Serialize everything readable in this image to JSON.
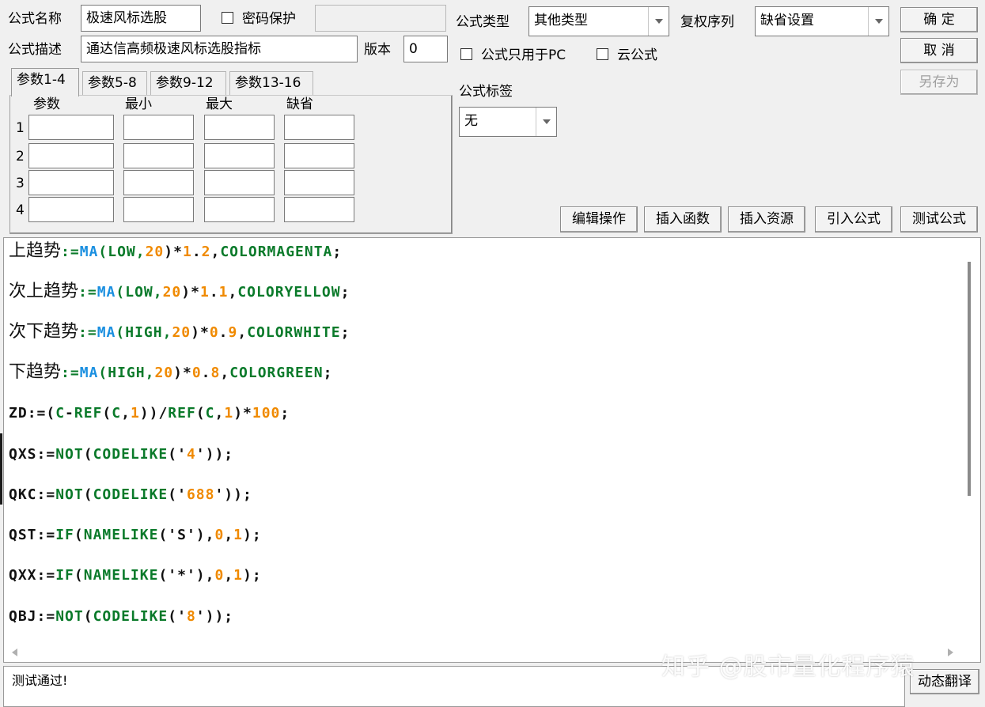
{
  "header": {
    "name_label": "公式名称",
    "name_value": "极速风标选股",
    "password_label": "密码保护",
    "desc_label": "公式描述",
    "desc_value": "通达信高频极速风标选股指标",
    "version_label": "版本",
    "version_value": "0"
  },
  "type_panel": {
    "type_label": "公式类型",
    "type_value": "其他类型",
    "rights_label": "复权序列",
    "rights_value": "缺省设置",
    "pc_only_label": "公式只用于PC",
    "cloud_label": "云公式",
    "tag_label": "公式标签",
    "tag_value": "无"
  },
  "buttons": {
    "ok": "确  定",
    "cancel": "取  消",
    "save_as": "另存为",
    "edit_ops": "编辑操作",
    "insert_func": "插入函数",
    "insert_res": "插入资源",
    "import_formula": "引入公式",
    "test_formula": "测试公式",
    "dyn_translate": "动态翻译"
  },
  "tabs": [
    "参数1-4",
    "参数5-8",
    "参数9-12",
    "参数13-16"
  ],
  "params": {
    "headers": [
      "参数",
      "最小",
      "最大",
      "缺省"
    ],
    "rows": [
      "1",
      "2",
      "3",
      "4"
    ]
  },
  "code": [
    [
      {
        "t": "上趋势",
        "c": "cjk"
      },
      {
        "t": ":=",
        "c": "#0a7a2a"
      },
      {
        "t": "MA",
        "c": "#1a8fe0"
      },
      {
        "t": "(",
        "c": "#0a7a2a"
      },
      {
        "t": "LOW",
        "c": "#0a7a2a"
      },
      {
        "t": ",",
        "c": "#0a7a2a"
      },
      {
        "t": "20",
        "c": "#f08a00"
      },
      {
        "t": ")*",
        "c": "#111111"
      },
      {
        "t": "1",
        "c": "#f08a00"
      },
      {
        "t": ".",
        "c": "#111111"
      },
      {
        "t": "2",
        "c": "#f08a00"
      },
      {
        "t": ",",
        "c": "#111111"
      },
      {
        "t": "COLORMAGENTA",
        "c": "#0a7a2a"
      },
      {
        "t": ";",
        "c": "#111111"
      }
    ],
    [
      {
        "t": "次上趋势",
        "c": "cjk"
      },
      {
        "t": ":=",
        "c": "#0a7a2a"
      },
      {
        "t": "MA",
        "c": "#1a8fe0"
      },
      {
        "t": "(",
        "c": "#0a7a2a"
      },
      {
        "t": "LOW",
        "c": "#0a7a2a"
      },
      {
        "t": ",",
        "c": "#0a7a2a"
      },
      {
        "t": "20",
        "c": "#f08a00"
      },
      {
        "t": ")*",
        "c": "#111111"
      },
      {
        "t": "1",
        "c": "#f08a00"
      },
      {
        "t": ".",
        "c": "#111111"
      },
      {
        "t": "1",
        "c": "#f08a00"
      },
      {
        "t": ",",
        "c": "#111111"
      },
      {
        "t": "COLORYELLOW",
        "c": "#0a7a2a"
      },
      {
        "t": ";",
        "c": "#111111"
      }
    ],
    [
      {
        "t": "次下趋势",
        "c": "cjk"
      },
      {
        "t": ":=",
        "c": "#0a7a2a"
      },
      {
        "t": "MA",
        "c": "#1a8fe0"
      },
      {
        "t": "(",
        "c": "#0a7a2a"
      },
      {
        "t": "HIGH",
        "c": "#0a7a2a"
      },
      {
        "t": ",",
        "c": "#0a7a2a"
      },
      {
        "t": "20",
        "c": "#f08a00"
      },
      {
        "t": ")*",
        "c": "#111111"
      },
      {
        "t": "0",
        "c": "#f08a00"
      },
      {
        "t": ".",
        "c": "#111111"
      },
      {
        "t": "9",
        "c": "#f08a00"
      },
      {
        "t": ",",
        "c": "#111111"
      },
      {
        "t": "COLORWHITE",
        "c": "#0a7a2a"
      },
      {
        "t": ";",
        "c": "#111111"
      }
    ],
    [
      {
        "t": "下趋势",
        "c": "cjk"
      },
      {
        "t": ":=",
        "c": "#0a7a2a"
      },
      {
        "t": "MA",
        "c": "#1a8fe0"
      },
      {
        "t": "(",
        "c": "#0a7a2a"
      },
      {
        "t": "HIGH",
        "c": "#0a7a2a"
      },
      {
        "t": ",",
        "c": "#0a7a2a"
      },
      {
        "t": "20",
        "c": "#f08a00"
      },
      {
        "t": ")*",
        "c": "#111111"
      },
      {
        "t": "0",
        "c": "#f08a00"
      },
      {
        "t": ".",
        "c": "#111111"
      },
      {
        "t": "8",
        "c": "#f08a00"
      },
      {
        "t": ",",
        "c": "#111111"
      },
      {
        "t": "COLORGREEN",
        "c": "#0a7a2a"
      },
      {
        "t": ";",
        "c": "#111111"
      }
    ],
    [
      {
        "t": "ZD",
        "c": "#111111"
      },
      {
        "t": ":=(",
        "c": "#111111"
      },
      {
        "t": "C",
        "c": "#0a7a2a"
      },
      {
        "t": "-",
        "c": "#111111"
      },
      {
        "t": "REF",
        "c": "#0a7a2a"
      },
      {
        "t": "(",
        "c": "#111111"
      },
      {
        "t": "C",
        "c": "#0a7a2a"
      },
      {
        "t": ",",
        "c": "#111111"
      },
      {
        "t": "1",
        "c": "#f08a00"
      },
      {
        "t": "))/",
        "c": "#111111"
      },
      {
        "t": "REF",
        "c": "#0a7a2a"
      },
      {
        "t": "(",
        "c": "#111111"
      },
      {
        "t": "C",
        "c": "#0a7a2a"
      },
      {
        "t": ",",
        "c": "#111111"
      },
      {
        "t": "1",
        "c": "#f08a00"
      },
      {
        "t": ")*",
        "c": "#111111"
      },
      {
        "t": "100",
        "c": "#f08a00"
      },
      {
        "t": ";",
        "c": "#111111"
      }
    ],
    [
      {
        "t": "QXS",
        "c": "#111111"
      },
      {
        "t": ":=",
        "c": "#111111"
      },
      {
        "t": "NOT",
        "c": "#0a7a2a"
      },
      {
        "t": "(",
        "c": "#111111"
      },
      {
        "t": "CODELIKE",
        "c": "#0a7a2a"
      },
      {
        "t": "('",
        "c": "#111111"
      },
      {
        "t": "4",
        "c": "#f08a00"
      },
      {
        "t": "'));",
        "c": "#111111"
      }
    ],
    [
      {
        "t": "QKC",
        "c": "#111111"
      },
      {
        "t": ":=",
        "c": "#111111"
      },
      {
        "t": "NOT",
        "c": "#0a7a2a"
      },
      {
        "t": "(",
        "c": "#111111"
      },
      {
        "t": "CODELIKE",
        "c": "#0a7a2a"
      },
      {
        "t": "('",
        "c": "#111111"
      },
      {
        "t": "688",
        "c": "#f08a00"
      },
      {
        "t": "'));",
        "c": "#111111"
      }
    ],
    [
      {
        "t": "QST",
        "c": "#111111"
      },
      {
        "t": ":=",
        "c": "#111111"
      },
      {
        "t": "IF",
        "c": "#0a7a2a"
      },
      {
        "t": "(",
        "c": "#111111"
      },
      {
        "t": "NAMELIKE",
        "c": "#0a7a2a"
      },
      {
        "t": "('S'),",
        "c": "#111111"
      },
      {
        "t": "0",
        "c": "#f08a00"
      },
      {
        "t": ",",
        "c": "#111111"
      },
      {
        "t": "1",
        "c": "#f08a00"
      },
      {
        "t": ");",
        "c": "#111111"
      }
    ],
    [
      {
        "t": "QXX",
        "c": "#111111"
      },
      {
        "t": ":=",
        "c": "#111111"
      },
      {
        "t": "IF",
        "c": "#0a7a2a"
      },
      {
        "t": "(",
        "c": "#111111"
      },
      {
        "t": "NAMELIKE",
        "c": "#0a7a2a"
      },
      {
        "t": "('*'),",
        "c": "#111111"
      },
      {
        "t": "0",
        "c": "#f08a00"
      },
      {
        "t": ",",
        "c": "#111111"
      },
      {
        "t": "1",
        "c": "#f08a00"
      },
      {
        "t": ");",
        "c": "#111111"
      }
    ],
    [
      {
        "t": "QBJ",
        "c": "#111111"
      },
      {
        "t": ":=",
        "c": "#111111"
      },
      {
        "t": "NOT",
        "c": "#0a7a2a"
      },
      {
        "t": "(",
        "c": "#111111"
      },
      {
        "t": "CODELIKE",
        "c": "#0a7a2a"
      },
      {
        "t": "('",
        "c": "#111111"
      },
      {
        "t": "8",
        "c": "#f08a00"
      },
      {
        "t": "'));",
        "c": "#111111"
      }
    ]
  ],
  "status_text": "测试通过!",
  "watermark": "知乎 @股市量化程序猿"
}
